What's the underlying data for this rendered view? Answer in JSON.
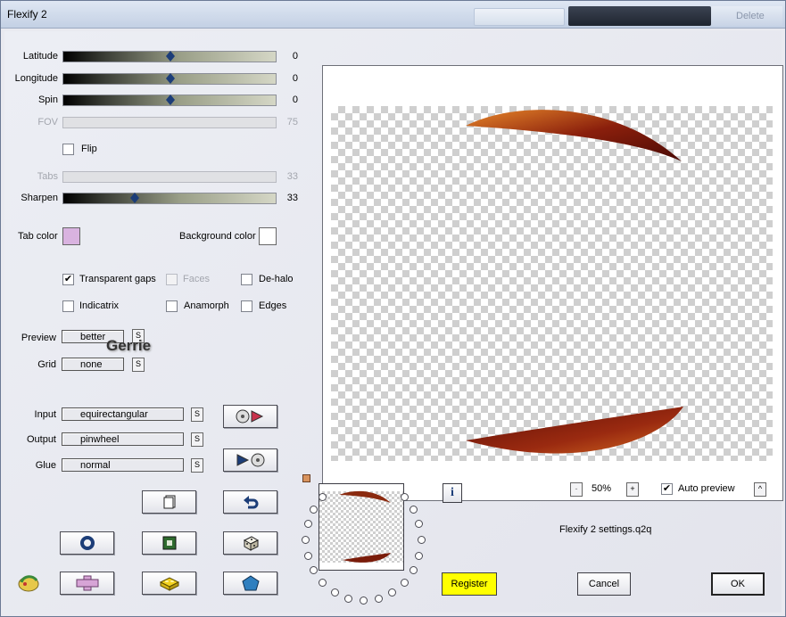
{
  "window": {
    "title": "Flexify 2",
    "titlebar_right": "Delete"
  },
  "sliders": [
    {
      "label": "Latitude",
      "value": "0",
      "enabled": true,
      "level": 0.5
    },
    {
      "label": "Longitude",
      "value": "0",
      "enabled": true,
      "level": 0.5
    },
    {
      "label": "Spin",
      "value": "0",
      "enabled": true,
      "level": 0.5
    },
    {
      "label": "FOV",
      "value": "75",
      "enabled": false
    },
    {
      "label": "Tabs",
      "value": "33",
      "enabled": false
    },
    {
      "label": "Sharpen",
      "value": "33",
      "enabled": true,
      "level": 0.33
    }
  ],
  "flip": {
    "label": "Flip",
    "checked": false
  },
  "colors": {
    "tab_color_label": "Tab color",
    "tab_color": "#d9b3e0",
    "background_color_label": "Background color",
    "background_color": "#ffffff"
  },
  "options": [
    {
      "label": "Transparent gaps",
      "checked": true,
      "enabled": true
    },
    {
      "label": "Faces",
      "checked": false,
      "enabled": false
    },
    {
      "label": "De-halo",
      "checked": false,
      "enabled": true
    },
    {
      "label": "Indicatrix",
      "checked": false,
      "enabled": true
    },
    {
      "label": "Anamorph",
      "checked": false,
      "enabled": true
    },
    {
      "label": "Edges",
      "checked": false,
      "enabled": true
    }
  ],
  "preview_quality": {
    "label": "Preview",
    "value": "better"
  },
  "grid": {
    "label": "Grid",
    "value": "none"
  },
  "watermark": "Gerrie",
  "projection": {
    "input_label": "Input",
    "input_value": "equirectangular",
    "output_label": "Output",
    "output_value": "pinwheel",
    "glue_label": "Glue",
    "glue_value": "normal"
  },
  "s_button": "S",
  "zoom": {
    "value": "50%",
    "minus": "-",
    "plus": "+"
  },
  "auto_preview": {
    "label": "Auto preview",
    "checked": true
  },
  "expand_button": "^",
  "info_button": "i",
  "settings_file": "Flexify 2 settings.q2q",
  "buttons": {
    "register": "Register",
    "cancel": "Cancel",
    "ok": "OK"
  },
  "accent_colors": {
    "register_bg": "#ffff00",
    "slider_thumb": "#1c3d78"
  }
}
